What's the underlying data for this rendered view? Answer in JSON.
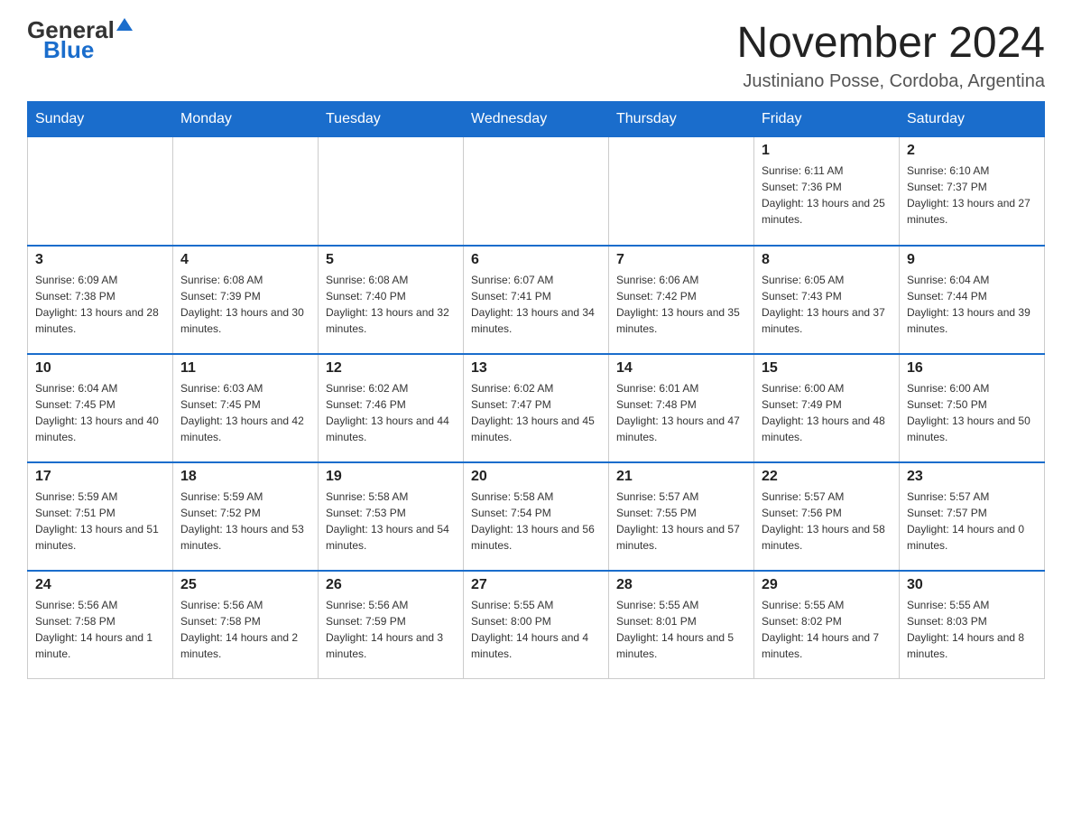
{
  "header": {
    "logo_general": "General",
    "logo_blue": "Blue",
    "month_year": "November 2024",
    "location": "Justiniano Posse, Cordoba, Argentina"
  },
  "weekdays": [
    "Sunday",
    "Monday",
    "Tuesday",
    "Wednesday",
    "Thursday",
    "Friday",
    "Saturday"
  ],
  "weeks": [
    [
      {
        "day": "",
        "info": ""
      },
      {
        "day": "",
        "info": ""
      },
      {
        "day": "",
        "info": ""
      },
      {
        "day": "",
        "info": ""
      },
      {
        "day": "",
        "info": ""
      },
      {
        "day": "1",
        "info": "Sunrise: 6:11 AM\nSunset: 7:36 PM\nDaylight: 13 hours and 25 minutes."
      },
      {
        "day": "2",
        "info": "Sunrise: 6:10 AM\nSunset: 7:37 PM\nDaylight: 13 hours and 27 minutes."
      }
    ],
    [
      {
        "day": "3",
        "info": "Sunrise: 6:09 AM\nSunset: 7:38 PM\nDaylight: 13 hours and 28 minutes."
      },
      {
        "day": "4",
        "info": "Sunrise: 6:08 AM\nSunset: 7:39 PM\nDaylight: 13 hours and 30 minutes."
      },
      {
        "day": "5",
        "info": "Sunrise: 6:08 AM\nSunset: 7:40 PM\nDaylight: 13 hours and 32 minutes."
      },
      {
        "day": "6",
        "info": "Sunrise: 6:07 AM\nSunset: 7:41 PM\nDaylight: 13 hours and 34 minutes."
      },
      {
        "day": "7",
        "info": "Sunrise: 6:06 AM\nSunset: 7:42 PM\nDaylight: 13 hours and 35 minutes."
      },
      {
        "day": "8",
        "info": "Sunrise: 6:05 AM\nSunset: 7:43 PM\nDaylight: 13 hours and 37 minutes."
      },
      {
        "day": "9",
        "info": "Sunrise: 6:04 AM\nSunset: 7:44 PM\nDaylight: 13 hours and 39 minutes."
      }
    ],
    [
      {
        "day": "10",
        "info": "Sunrise: 6:04 AM\nSunset: 7:45 PM\nDaylight: 13 hours and 40 minutes."
      },
      {
        "day": "11",
        "info": "Sunrise: 6:03 AM\nSunset: 7:45 PM\nDaylight: 13 hours and 42 minutes."
      },
      {
        "day": "12",
        "info": "Sunrise: 6:02 AM\nSunset: 7:46 PM\nDaylight: 13 hours and 44 minutes."
      },
      {
        "day": "13",
        "info": "Sunrise: 6:02 AM\nSunset: 7:47 PM\nDaylight: 13 hours and 45 minutes."
      },
      {
        "day": "14",
        "info": "Sunrise: 6:01 AM\nSunset: 7:48 PM\nDaylight: 13 hours and 47 minutes."
      },
      {
        "day": "15",
        "info": "Sunrise: 6:00 AM\nSunset: 7:49 PM\nDaylight: 13 hours and 48 minutes."
      },
      {
        "day": "16",
        "info": "Sunrise: 6:00 AM\nSunset: 7:50 PM\nDaylight: 13 hours and 50 minutes."
      }
    ],
    [
      {
        "day": "17",
        "info": "Sunrise: 5:59 AM\nSunset: 7:51 PM\nDaylight: 13 hours and 51 minutes."
      },
      {
        "day": "18",
        "info": "Sunrise: 5:59 AM\nSunset: 7:52 PM\nDaylight: 13 hours and 53 minutes."
      },
      {
        "day": "19",
        "info": "Sunrise: 5:58 AM\nSunset: 7:53 PM\nDaylight: 13 hours and 54 minutes."
      },
      {
        "day": "20",
        "info": "Sunrise: 5:58 AM\nSunset: 7:54 PM\nDaylight: 13 hours and 56 minutes."
      },
      {
        "day": "21",
        "info": "Sunrise: 5:57 AM\nSunset: 7:55 PM\nDaylight: 13 hours and 57 minutes."
      },
      {
        "day": "22",
        "info": "Sunrise: 5:57 AM\nSunset: 7:56 PM\nDaylight: 13 hours and 58 minutes."
      },
      {
        "day": "23",
        "info": "Sunrise: 5:57 AM\nSunset: 7:57 PM\nDaylight: 14 hours and 0 minutes."
      }
    ],
    [
      {
        "day": "24",
        "info": "Sunrise: 5:56 AM\nSunset: 7:58 PM\nDaylight: 14 hours and 1 minute."
      },
      {
        "day": "25",
        "info": "Sunrise: 5:56 AM\nSunset: 7:58 PM\nDaylight: 14 hours and 2 minutes."
      },
      {
        "day": "26",
        "info": "Sunrise: 5:56 AM\nSunset: 7:59 PM\nDaylight: 14 hours and 3 minutes."
      },
      {
        "day": "27",
        "info": "Sunrise: 5:55 AM\nSunset: 8:00 PM\nDaylight: 14 hours and 4 minutes."
      },
      {
        "day": "28",
        "info": "Sunrise: 5:55 AM\nSunset: 8:01 PM\nDaylight: 14 hours and 5 minutes."
      },
      {
        "day": "29",
        "info": "Sunrise: 5:55 AM\nSunset: 8:02 PM\nDaylight: 14 hours and 7 minutes."
      },
      {
        "day": "30",
        "info": "Sunrise: 5:55 AM\nSunset: 8:03 PM\nDaylight: 14 hours and 8 minutes."
      }
    ]
  ]
}
